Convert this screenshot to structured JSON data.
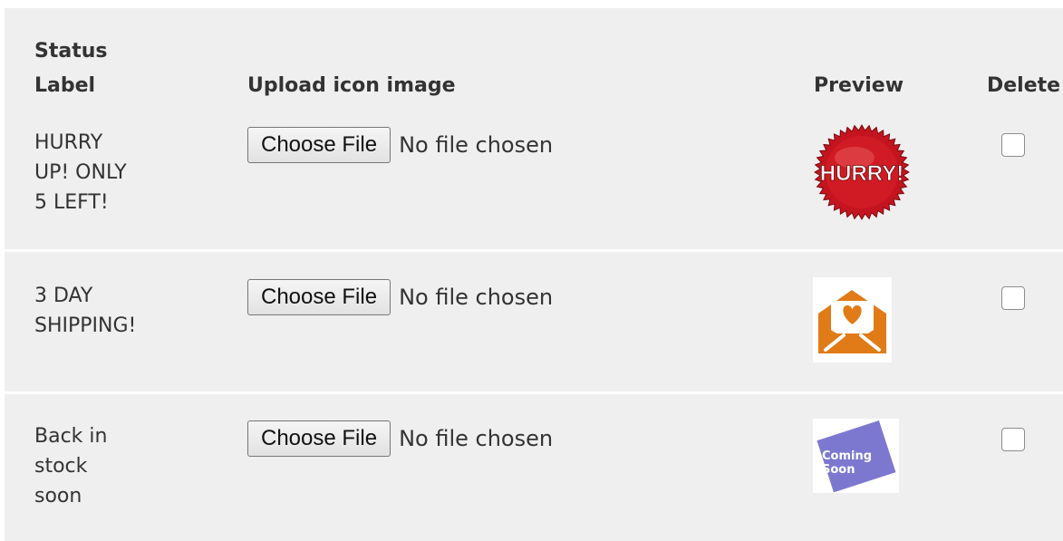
{
  "table": {
    "headers": {
      "status_label": "Status\nLabel",
      "upload": "Upload icon image",
      "preview": "Preview",
      "delete": "Delete"
    },
    "rows": [
      {
        "label": "HURRY\nUP! ONLY\n5 LEFT!",
        "file_button": "Choose File",
        "file_status": "No file chosen",
        "preview_icon": "hurry-badge-icon",
        "preview_text": "HURRY!",
        "delete_checked": false
      },
      {
        "label": "3 DAY\nSHIPPING!",
        "file_button": "Choose File",
        "file_status": "No file chosen",
        "preview_icon": "envelope-heart-icon",
        "delete_checked": false
      },
      {
        "label": "Back in\nstock\nsoon",
        "file_button": "Choose File",
        "file_status": "No file chosen",
        "preview_icon": "coming-soon-icon",
        "preview_text": "Coming\nSoon",
        "delete_checked": false
      }
    ]
  },
  "colors": {
    "panel_bg": "#efefef",
    "hurry_red": "#c4141f",
    "envelope_orange": "#e07b17",
    "coming_soon_purple": "#7d78cf"
  }
}
